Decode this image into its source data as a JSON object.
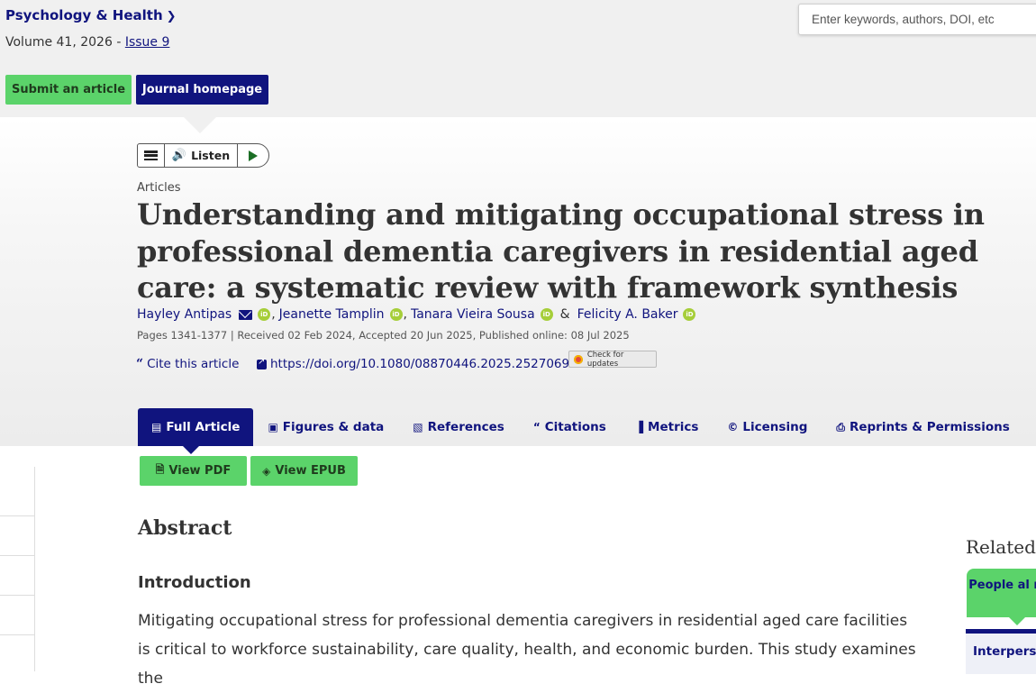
{
  "journal": {
    "title": "Psychology & Health",
    "volume_text": "Volume 41, 2026 - ",
    "issue_link": "Issue 9"
  },
  "header_buttons": {
    "submit": "Submit an article",
    "homepage": "Journal homepage"
  },
  "search": {
    "placeholder": "Enter keywords, authors, DOI, etc"
  },
  "player": {
    "listen_label": "Listen"
  },
  "article": {
    "type": "Articles",
    "title": "Understanding and mitigating occupational stress in professional dementia caregivers in residential aged care: a systematic review with framework synthesis",
    "authors": [
      "Hayley Antipas",
      "Jeanette Tamplin",
      "Tanara Vieira Sousa",
      "Felicity A. Baker"
    ],
    "separator": ",",
    "ampersand": "&",
    "pages_line": "Pages 1341-1377 | Received 02 Feb 2024, Accepted 20 Jun 2025, Published online: 08 Jul 2025",
    "cite_label": "Cite this article",
    "doi": "https://doi.org/10.1080/08870446.2025.2527069",
    "check_updates": "Check for updates"
  },
  "tabs": [
    {
      "label": "Full Article",
      "icon": "document-icon",
      "glyph": "▤"
    },
    {
      "label": "Figures & data",
      "icon": "image-icon",
      "glyph": "▣"
    },
    {
      "label": "References",
      "icon": "book-icon",
      "glyph": "▧"
    },
    {
      "label": "Citations",
      "icon": "quote-icon",
      "glyph": "“"
    },
    {
      "label": "Metrics",
      "icon": "bar-chart-icon",
      "glyph": "▐"
    },
    {
      "label": "Licensing",
      "icon": "copyright-icon",
      "glyph": "©"
    },
    {
      "label": "Reprints & Permissions",
      "icon": "print-icon",
      "glyph": "⎙"
    }
  ],
  "view_buttons": {
    "pdf": "View PDF",
    "epub": "View EPUB"
  },
  "abstract": {
    "heading": "Abstract",
    "section_heading": "Introduction",
    "text": "Mitigating occupational stress for professional dementia caregivers in residential aged care facilities is critical to workforce sustainability, care quality, health, and economic burden. This study examines the"
  },
  "related": {
    "heading": "Related r",
    "people_also": "People al read",
    "item_preview": "Interperso outcomes"
  },
  "colors": {
    "navy": "#10147e",
    "green": "#5bd36a",
    "orcid": "#a6ce39"
  }
}
